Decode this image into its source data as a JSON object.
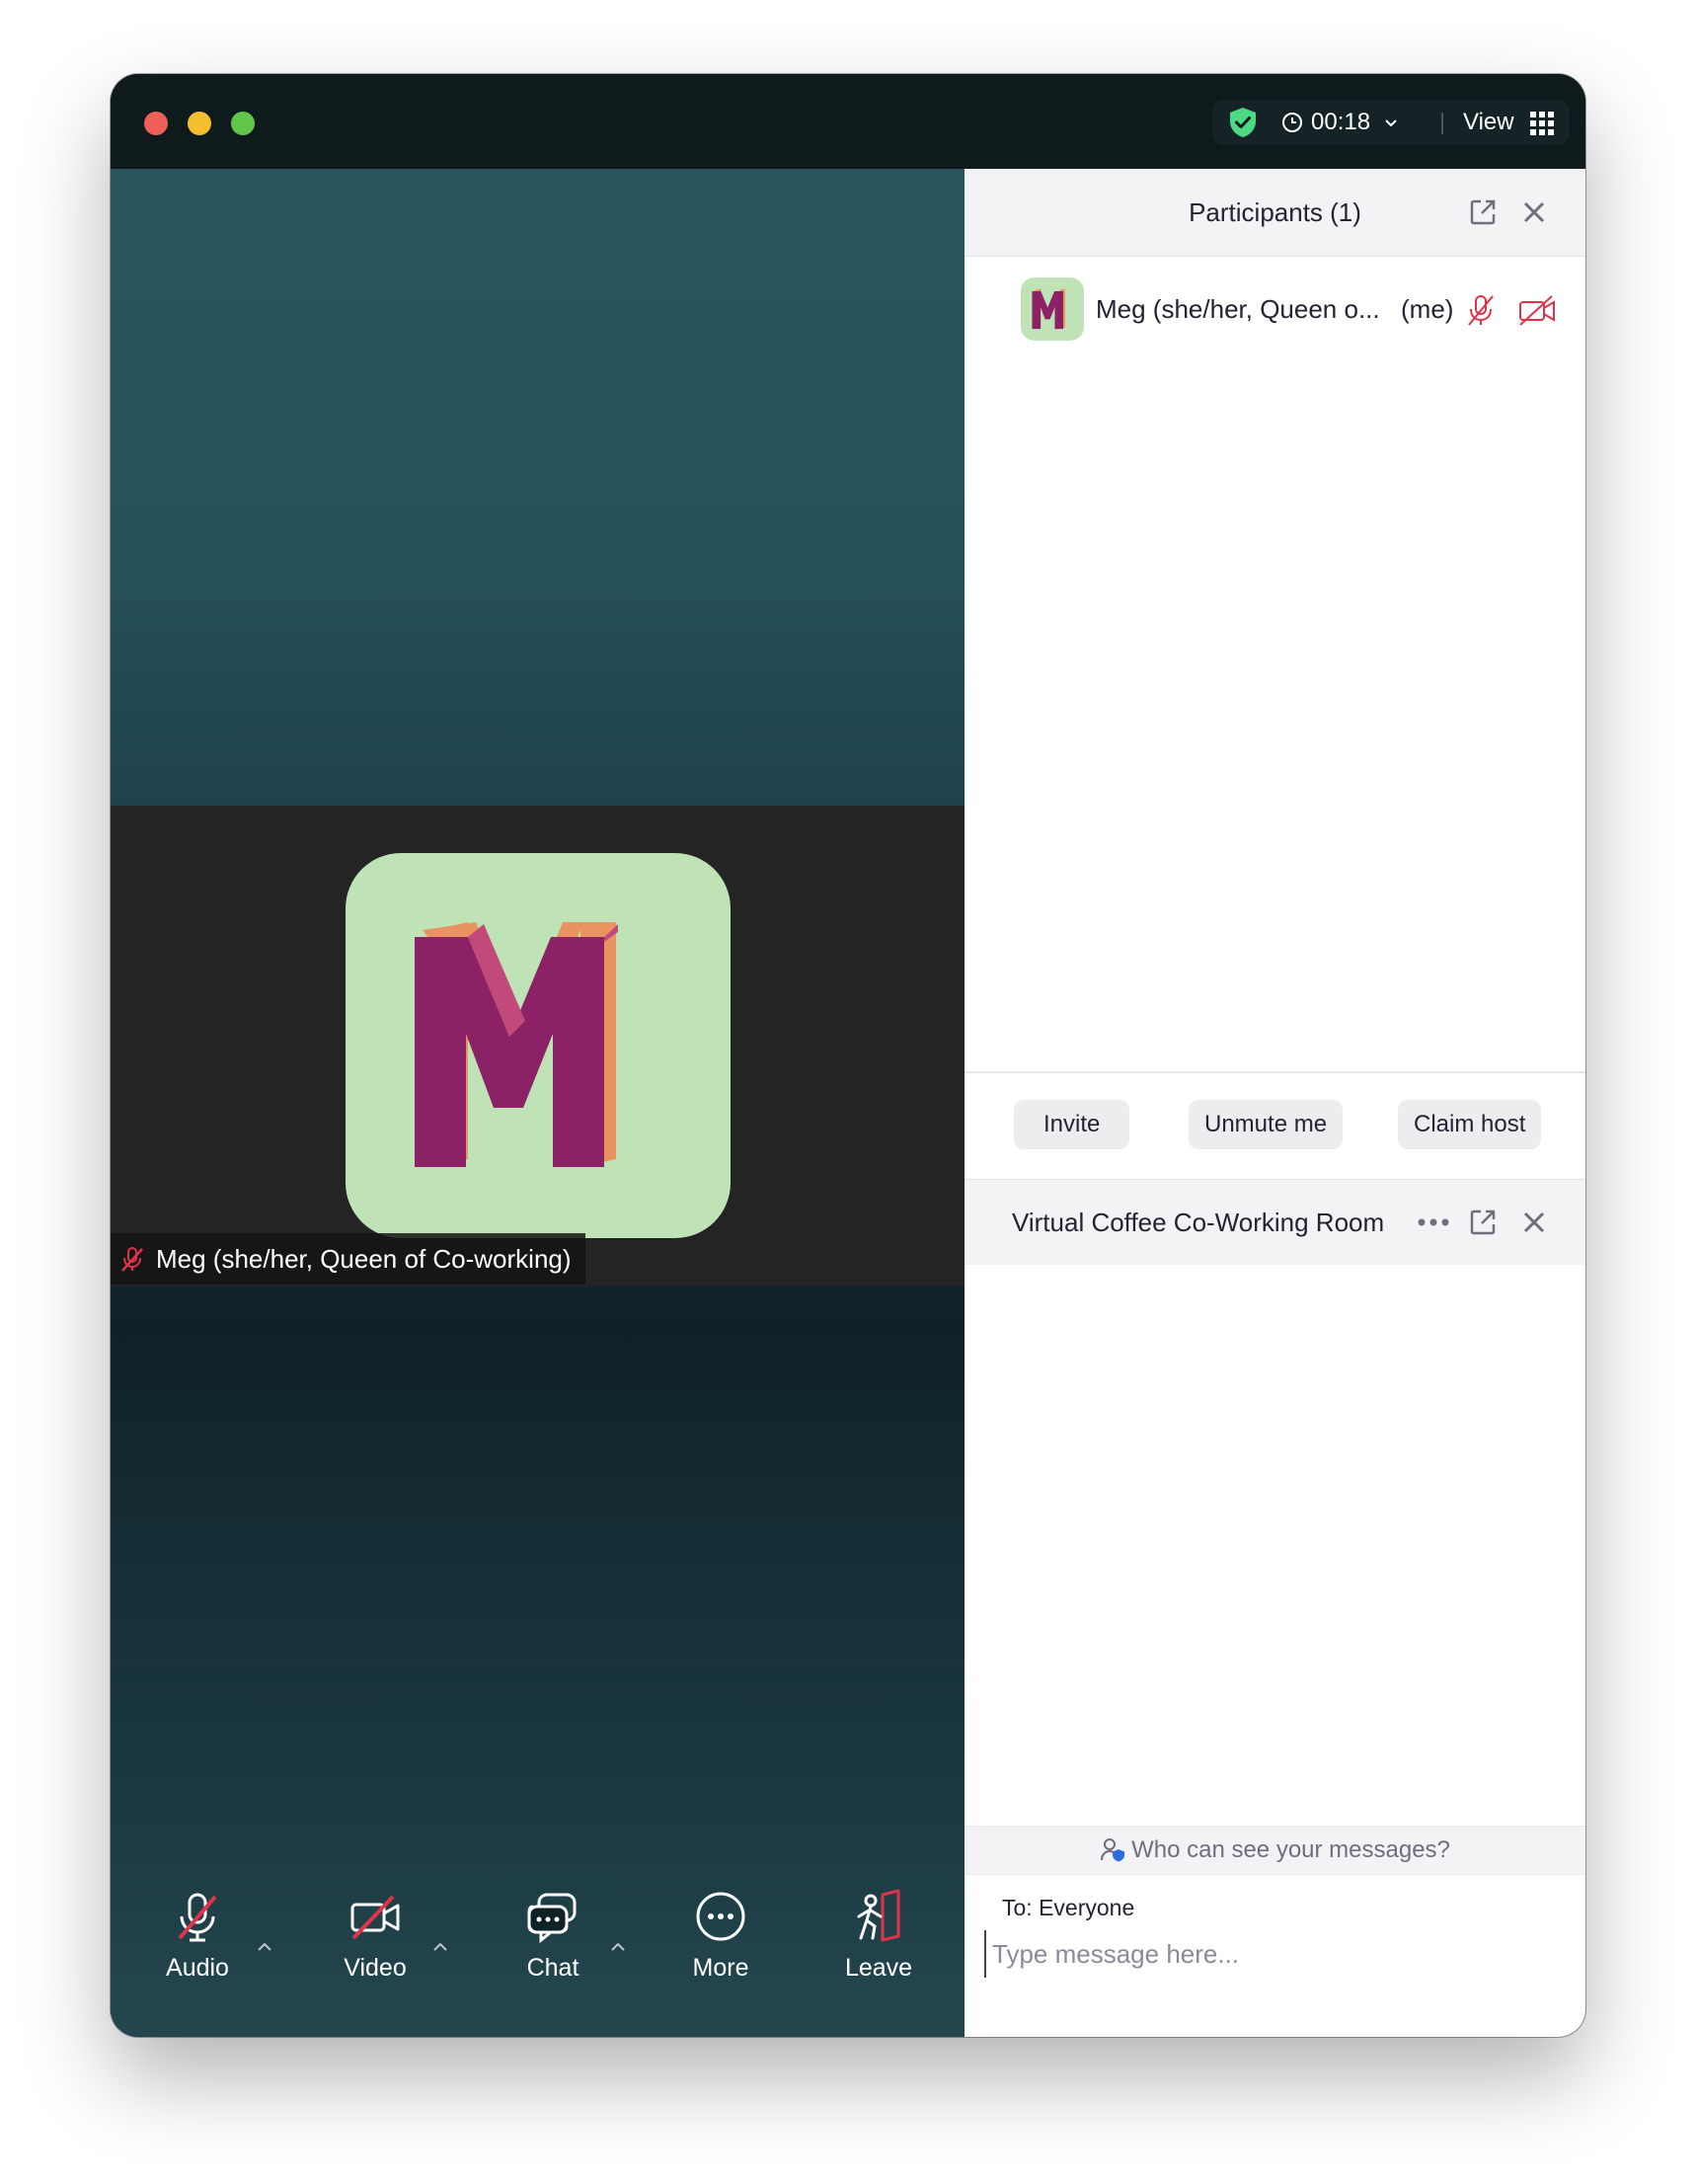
{
  "titlebar": {
    "timer": "00:18",
    "view_label": "View"
  },
  "video": {
    "participant_name": "Meg (she/her, Queen of Co-working)",
    "avatar_letter": "M"
  },
  "toolbar": {
    "audio_label": "Audio",
    "video_label": "Video",
    "chat_label": "Chat",
    "more_label": "More",
    "leave_label": "Leave"
  },
  "participants_panel": {
    "title": "Participants (1)",
    "participant": {
      "name": "Meg (she/her, Queen o...",
      "me_tag": "(me)",
      "mic_muted": true,
      "video_off": true
    },
    "buttons": {
      "invite": "Invite",
      "unmute": "Unmute me",
      "claim_host": "Claim host"
    }
  },
  "chat_panel": {
    "title": "Virtual Coffee Co-Working Room",
    "who_can_see": "Who can see your messages?",
    "to_label": "To: Everyone",
    "input_placeholder": "Type message here..."
  },
  "colors": {
    "avatar_bg": "#bfe3b7",
    "avatar_letter": "#8c2166",
    "avatar_side": "#ea9360",
    "muted_red": "#e0334a",
    "shield_green": "#4cd884"
  }
}
